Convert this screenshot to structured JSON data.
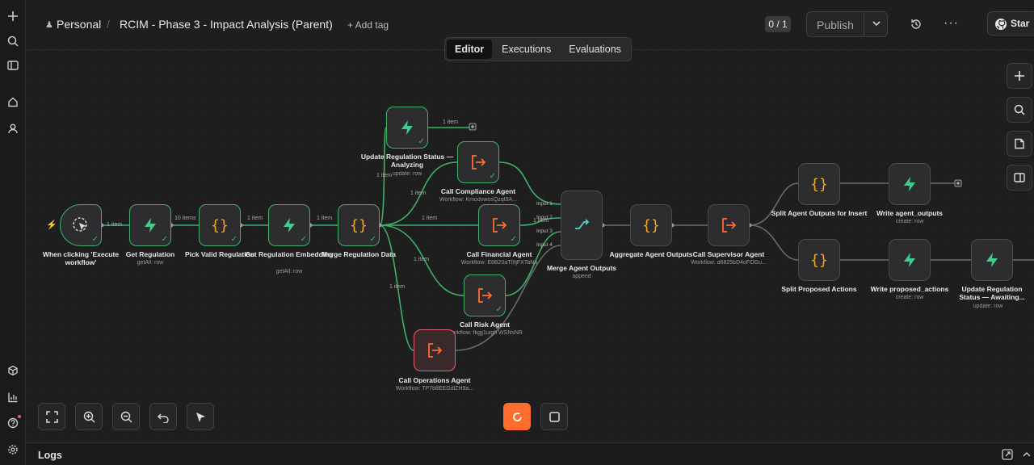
{
  "header": {
    "project": "Personal",
    "workflow_title": "RCIM - Phase 3 - Impact Analysis (Parent)",
    "add_tag": "+ Add tag",
    "counter": "0 / 1",
    "publish": "Publish",
    "star": "Star"
  },
  "tabs": [
    "Editor",
    "Executions",
    "Evaluations"
  ],
  "nodes": {
    "trigger": {
      "label": "When clicking 'Execute workflow'"
    },
    "get_regulation": {
      "label": "Get Regulation",
      "sub": "getAll: row"
    },
    "pick_valid": {
      "label": "Pick Valid Regulation"
    },
    "get_embedding": {
      "label": "Get Regulation Embedding",
      "sub": "getAll: row"
    },
    "merge_data": {
      "label": "Merge Regulation Data"
    },
    "update_analyzing": {
      "label": "Update Regulation Status — Analyzing",
      "sub": "update: row"
    },
    "compliance": {
      "label": "Call Compliance Agent",
      "sub": "Workflow: KmodvwosQzqI9A..."
    },
    "financial": {
      "label": "Call Financial Agent",
      "sub": "Workflow: E8B20aT0fjFXTaNa"
    },
    "risk": {
      "label": "Call Risk Agent",
      "sub": "Workflow: fkgjj1uigh WSNsNR"
    },
    "operations": {
      "label": "Call Operations Agent",
      "sub": "Workflow: TP7b8EEGdlZH9a..."
    },
    "merge_outputs": {
      "label": "Merge Agent Outputs",
      "sub": "append"
    },
    "aggregate": {
      "label": "Aggregate Agent Outputs"
    },
    "supervisor": {
      "label": "Call Supervisor Agent",
      "sub": "Workflow: d6825bD4oFOGu..."
    },
    "split_outputs": {
      "label": "Split Agent Outputs for Insert"
    },
    "write_outputs": {
      "label": "Write agent_outputs",
      "sub": "create: row"
    },
    "split_actions": {
      "label": "Split Proposed Actions"
    },
    "write_actions": {
      "label": "Write proposed_actions",
      "sub": "create: row"
    },
    "update_awaiting": {
      "label": "Update Regulation Status — Awaiting...",
      "sub": "update: row"
    }
  },
  "edges": {
    "e1": "1 item",
    "e2": "10 items",
    "e3": "1 item",
    "e4": "1 item",
    "e_update": "1 item",
    "e_update_in": "1 item",
    "e_comp": "1 item",
    "e_fin": "1 item",
    "e_risk": "1 item",
    "e_ops": "1 item",
    "e_fin_out": "1 item"
  },
  "inputs": [
    "Input 1",
    "Input 2",
    "Input 3",
    "Input 4"
  ],
  "footer": {
    "logs": "Logs"
  },
  "colors": {
    "success": "#3fb068",
    "error": "#e5606a",
    "accent": "#ff6d2e",
    "edge": "#3fb068"
  }
}
